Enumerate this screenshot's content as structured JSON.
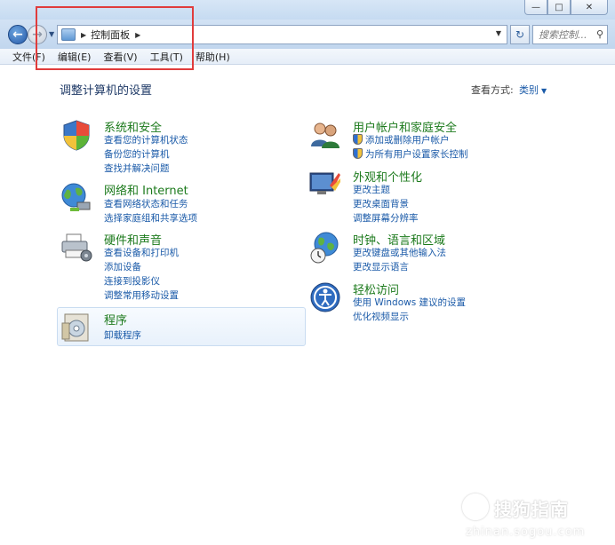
{
  "navbar": {
    "breadcrumb": "控制面板",
    "search_placeholder": "搜索控制..."
  },
  "menu": [
    "文件(F)",
    "编辑(E)",
    "查看(V)",
    "工具(T)",
    "帮助(H)"
  ],
  "header": {
    "title": "调整计算机的设置",
    "view_by_label": "查看方式:",
    "view_by_value": "类别"
  },
  "categories": {
    "system_security": {
      "title": "系统和安全",
      "links": [
        "查看您的计算机状态",
        "备份您的计算机",
        "查找并解决问题"
      ]
    },
    "network": {
      "title": "网络和 Internet",
      "links": [
        "查看网络状态和任务",
        "选择家庭组和共享选项"
      ]
    },
    "hardware": {
      "title": "硬件和声音",
      "links": [
        "查看设备和打印机",
        "添加设备",
        "连接到投影仪",
        "调整常用移动设置"
      ]
    },
    "programs": {
      "title": "程序",
      "links": [
        "卸载程序"
      ]
    },
    "user_accounts": {
      "title": "用户帐户和家庭安全",
      "links": [
        "添加或删除用户帐户",
        "为所有用户设置家长控制"
      ]
    },
    "appearance": {
      "title": "外观和个性化",
      "links": [
        "更改主题",
        "更改桌面背景",
        "调整屏幕分辨率"
      ]
    },
    "clock": {
      "title": "时钟、语言和区域",
      "links": [
        "更改键盘或其他输入法",
        "更改显示语言"
      ]
    },
    "ease": {
      "title": "轻松访问",
      "links": [
        "使用 Windows 建议的设置",
        "优化视频显示"
      ]
    }
  },
  "watermark": {
    "text": "搜狗指南",
    "url": "zhinan.sogou.com"
  },
  "colors": {
    "category_title": "#1c7a1c",
    "link": "#1a5aa8",
    "annotation_box": "#e03c3c"
  }
}
